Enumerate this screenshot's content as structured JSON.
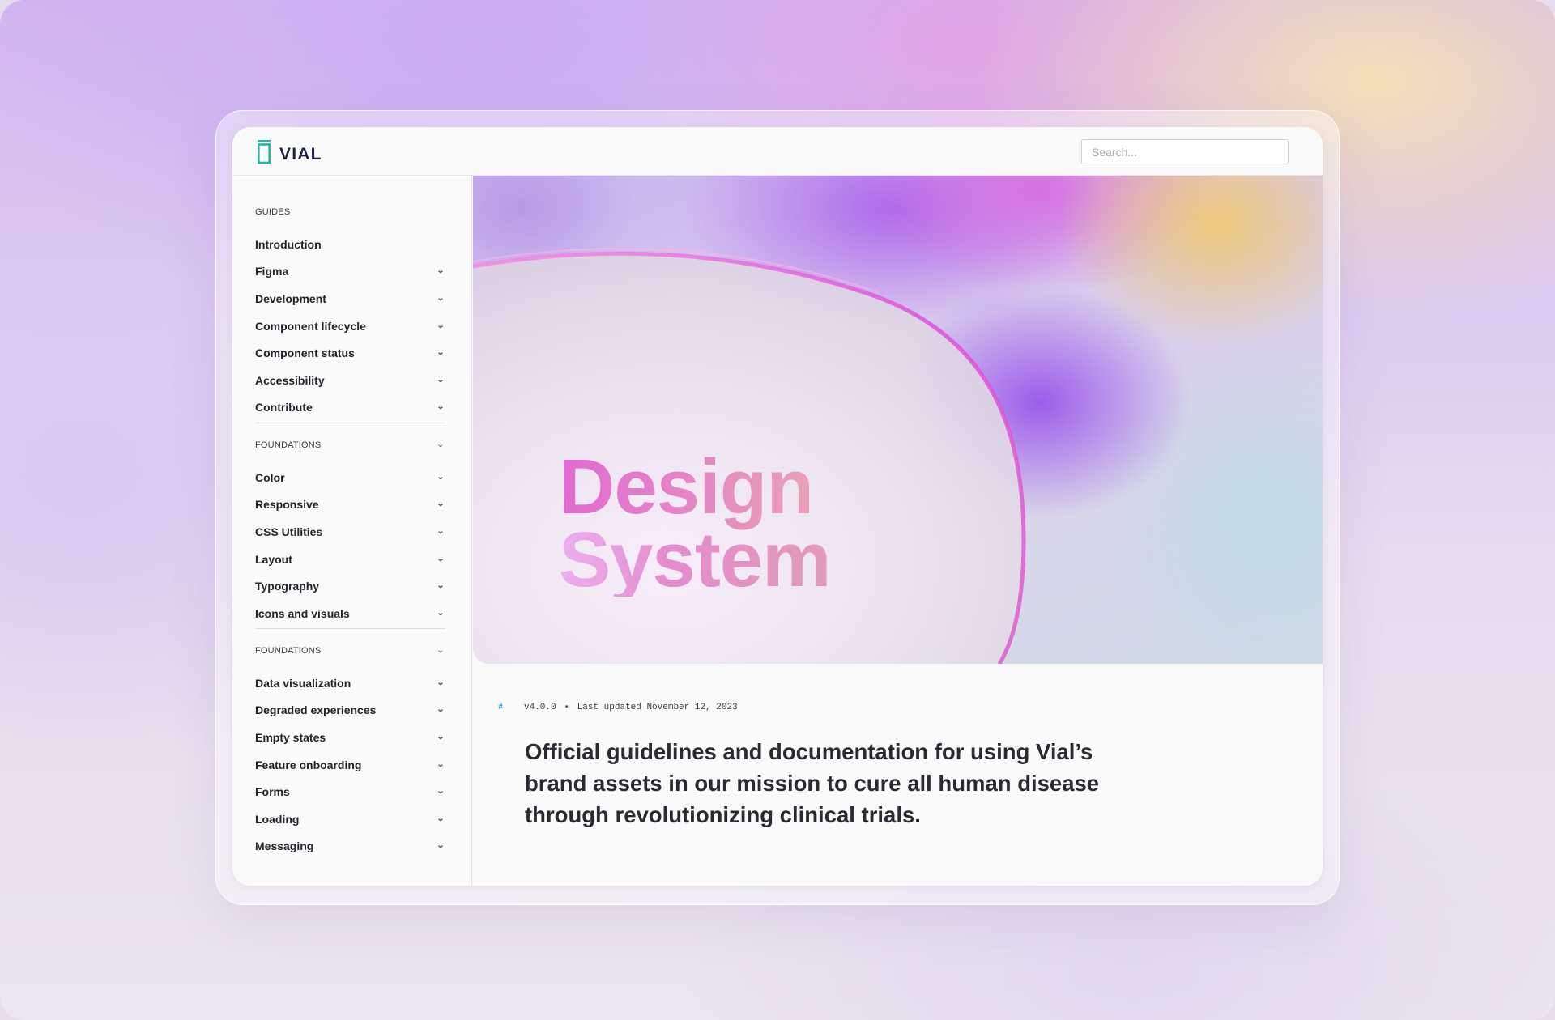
{
  "app": {
    "brand": "VIAL",
    "search_placeholder": "Search..."
  },
  "colors": {
    "accent": "#2bb3a0",
    "text": "#23232b",
    "link_hash": "#2f9be9",
    "hero_gradient_start": "#e06ad2",
    "hero_gradient_end": "#e9a5b4"
  },
  "sidebar": {
    "guides": {
      "heading": "GUIDES",
      "items": [
        {
          "label": "Introduction",
          "expandable": false
        },
        {
          "label": "Figma",
          "expandable": true
        },
        {
          "label": "Development",
          "expandable": true
        },
        {
          "label": "Component lifecycle",
          "expandable": true
        },
        {
          "label": "Component status",
          "expandable": true
        },
        {
          "label": "Accessibility",
          "expandable": true
        },
        {
          "label": "Contribute",
          "expandable": true
        }
      ]
    },
    "foundations_1": {
      "heading": "FOUNDATIONS",
      "items": [
        {
          "label": "Color",
          "expandable": true
        },
        {
          "label": "Responsive",
          "expandable": true
        },
        {
          "label": "CSS Utilities",
          "expandable": true
        },
        {
          "label": "Layout",
          "expandable": true
        },
        {
          "label": "Typography",
          "expandable": true
        },
        {
          "label": "Icons and visuals",
          "expandable": true
        }
      ]
    },
    "foundations_2": {
      "heading": "FOUNDATIONS",
      "items": [
        {
          "label": "Data visualization",
          "expandable": true
        },
        {
          "label": "Degraded experiences",
          "expandable": true
        },
        {
          "label": "Empty states",
          "expandable": true
        },
        {
          "label": "Feature onboarding",
          "expandable": true
        },
        {
          "label": "Forms",
          "expandable": true
        },
        {
          "label": "Loading",
          "expandable": true
        },
        {
          "label": "Messaging",
          "expandable": true
        }
      ]
    }
  },
  "hero": {
    "title_line1": "Design",
    "title_line2": "System"
  },
  "meta": {
    "anchor": "#",
    "version": "v4.0.0",
    "separator": "•",
    "updated": "Last updated November 12, 2023"
  },
  "lead": "Official guidelines and documentation for using Vial’s brand assets in our mission to cure all human disease through revolutionizing clinical trials."
}
